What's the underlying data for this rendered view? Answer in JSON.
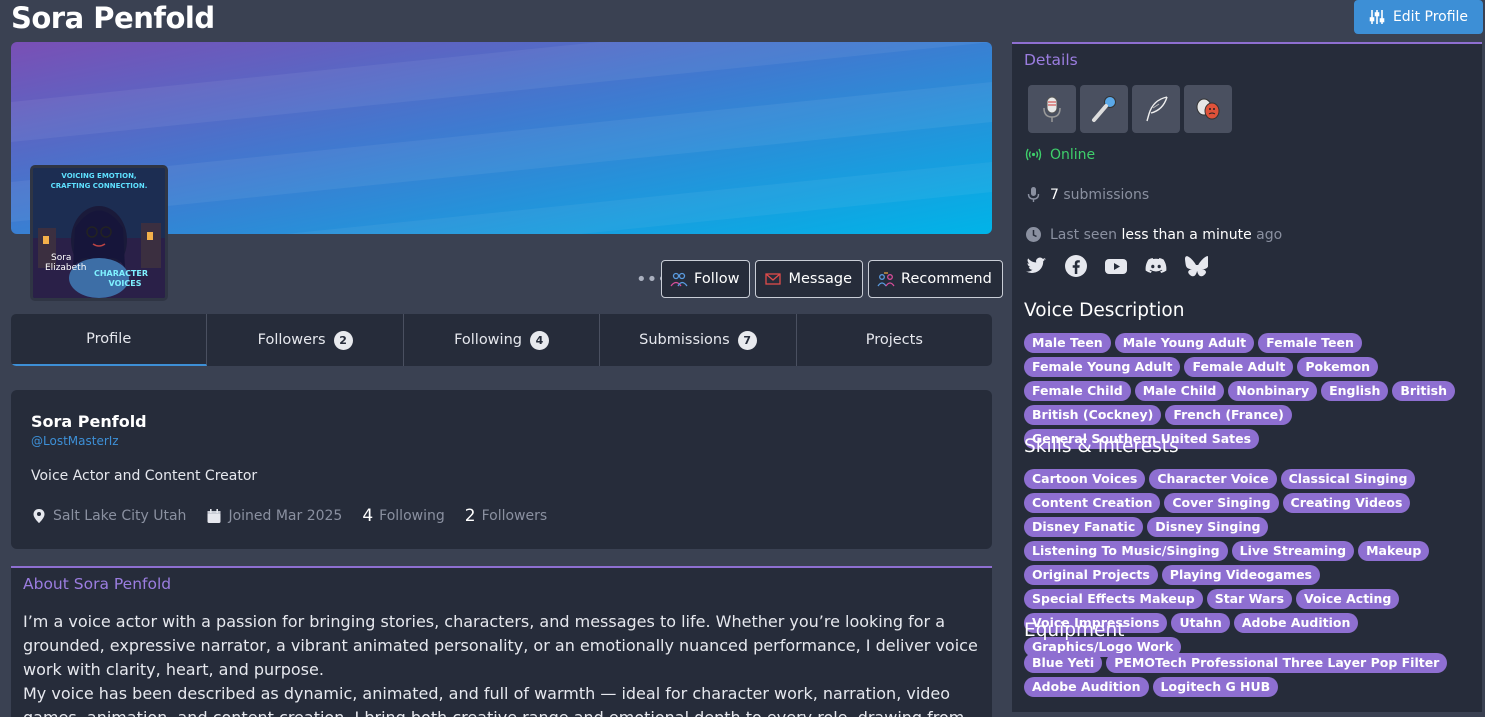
{
  "header": {
    "title": "Sora Penfold",
    "edit_label": "Edit Profile"
  },
  "avatar_text": {
    "line1": "VOICING EMOTION,",
    "line2": "CRAFTING CONNECTION.",
    "name1": "Sora",
    "name2": "Elizabeth",
    "brand1": "CHARACTER",
    "brand2": "VOICES"
  },
  "actions": {
    "more": "•••",
    "follow": "Follow",
    "message": "Message",
    "recommend": "Recommend"
  },
  "tabs": [
    {
      "label": "Profile",
      "count": null
    },
    {
      "label": "Followers",
      "count": "2"
    },
    {
      "label": "Following",
      "count": "4"
    },
    {
      "label": "Submissions",
      "count": "7"
    },
    {
      "label": "Projects",
      "count": null
    }
  ],
  "card": {
    "name": "Sora Penfold",
    "handle": "@LostMasterIz",
    "bio": "Voice Actor and Content Creator",
    "location": "Salt Lake City Utah",
    "joined": "Joined Mar 2025",
    "following_count": "4",
    "following_label": "Following",
    "followers_count": "2",
    "followers_label": "Followers"
  },
  "about": {
    "heading": "About Sora Penfold",
    "p1": "I’m a voice actor with a passion for bringing stories, characters, and messages to life. Whether you’re looking for a grounded, expressive narrator, a vibrant animated personality, or an emotionally nuanced performance, I deliver voice work with clarity, heart, and purpose.",
    "p2": "My voice has been described as dynamic, animated, and full of warmth — ideal for character work, narration, video games, animation, and content creation. I bring both creative range and emotional depth to every role, drawing from"
  },
  "details": {
    "heading": "Details",
    "status": "Online",
    "submissions_count": "7",
    "submissions_label": "submissions",
    "last_seen_prefix": "Last seen",
    "last_seen_value": "less than a minute",
    "last_seen_suffix": "ago",
    "icons": [
      "podcast-mic-icon",
      "handheld-mic-icon",
      "quill-icon",
      "theater-masks-icon"
    ],
    "social": [
      "twitter-icon",
      "facebook-icon",
      "youtube-icon",
      "discord-icon",
      "bluesky-icon"
    ]
  },
  "voice_description": {
    "heading": "Voice Description",
    "tags": [
      "Male Teen",
      "Male Young Adult",
      "Female Teen",
      "Female Young Adult",
      "Female Adult",
      "Pokemon",
      "Female Child",
      "Male Child",
      "Nonbinary",
      "English",
      "British",
      "British (Cockney)",
      "French (France)",
      "General Southern United Sates"
    ]
  },
  "skills": {
    "heading": "Skills & Interests",
    "tags": [
      "Cartoon Voices",
      "Character Voice",
      "Classical Singing",
      "Content Creation",
      "Cover Singing",
      "Creating Videos",
      "Disney Fanatic",
      "Disney Singing",
      "Listening To Music/Singing",
      "Live Streaming",
      "Makeup",
      "Original Projects",
      "Playing Videogames",
      "Special Effects Makeup",
      "Star Wars",
      "Voice Acting",
      "Voice Impressions",
      "Utahn",
      "Adobe Audition",
      "Graphics/Logo Work"
    ]
  },
  "equipment": {
    "heading": "Equipment",
    "tags": [
      "Blue Yeti",
      "PEMOTech Professional Three Layer Pop Filter",
      "Adobe Audition",
      "Logitech G HUB"
    ]
  },
  "colors": {
    "accent": "#3d8fd6",
    "purple": "#8e6fd1",
    "online": "#3ecf6b",
    "panel": "#262c3a",
    "background": "#3a4152"
  }
}
